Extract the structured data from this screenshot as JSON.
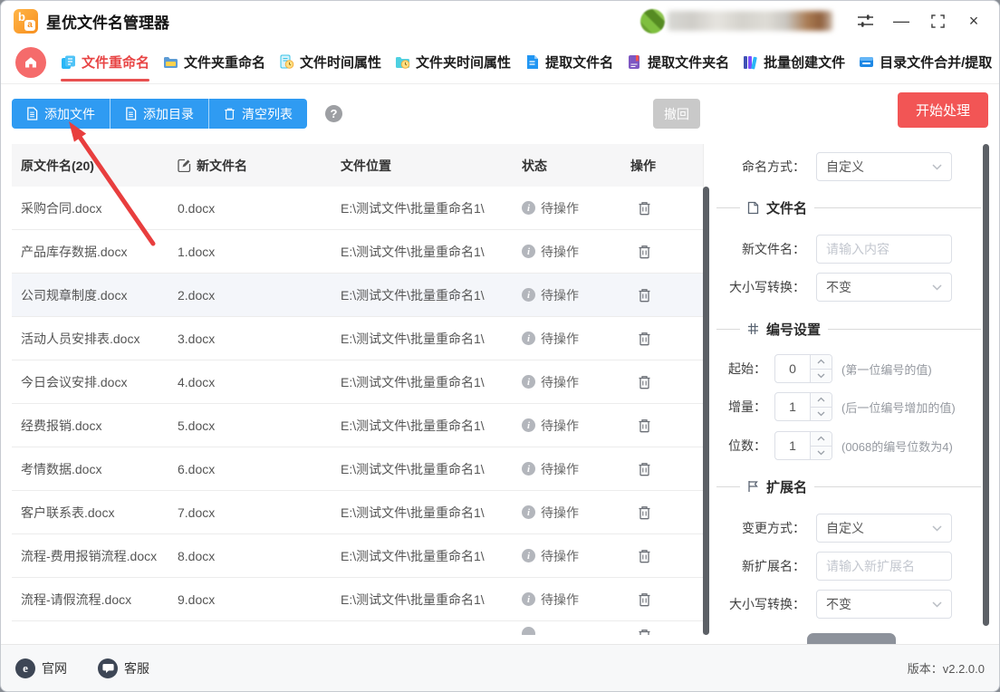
{
  "app": {
    "title": "星优文件名管理器"
  },
  "icons": {
    "minimize": "—",
    "close": "×",
    "help": "?",
    "info": "i",
    "site_glyph": "e"
  },
  "tabs": [
    {
      "label": "文件重命名",
      "active": true
    },
    {
      "label": "文件夹重命名",
      "active": false
    },
    {
      "label": "文件时间属性",
      "active": false
    },
    {
      "label": "文件夹时间属性",
      "active": false
    },
    {
      "label": "提取文件名",
      "active": false
    },
    {
      "label": "提取文件夹名",
      "active": false
    },
    {
      "label": "批量创建文件",
      "active": false
    },
    {
      "label": "目录文件合并/提取",
      "active": false
    }
  ],
  "toolbar": {
    "add_files": "添加文件",
    "add_folder": "添加目录",
    "clear_list": "清空列表",
    "undo": "撤回",
    "start": "开始处理"
  },
  "table": {
    "headers": {
      "original": "原文件名(20)",
      "new_name": "新文件名",
      "location": "文件位置",
      "status": "状态",
      "action": "操作"
    },
    "rows": [
      {
        "original": "采购合同.docx",
        "new_name": "0.docx",
        "location": "E:\\测试文件\\批量重命名1\\",
        "status": "待操作"
      },
      {
        "original": "产品库存数据.docx",
        "new_name": "1.docx",
        "location": "E:\\测试文件\\批量重命名1\\",
        "status": "待操作"
      },
      {
        "original": "公司规章制度.docx",
        "new_name": "2.docx",
        "location": "E:\\测试文件\\批量重命名1\\",
        "status": "待操作"
      },
      {
        "original": "活动人员安排表.docx",
        "new_name": "3.docx",
        "location": "E:\\测试文件\\批量重命名1\\",
        "status": "待操作"
      },
      {
        "original": "今日会议安排.docx",
        "new_name": "4.docx",
        "location": "E:\\测试文件\\批量重命名1\\",
        "status": "待操作"
      },
      {
        "original": "经费报销.docx",
        "new_name": "5.docx",
        "location": "E:\\测试文件\\批量重命名1\\",
        "status": "待操作"
      },
      {
        "original": "考情数据.docx",
        "new_name": "6.docx",
        "location": "E:\\测试文件\\批量重命名1\\",
        "status": "待操作"
      },
      {
        "original": "客户联系表.docx",
        "new_name": "7.docx",
        "location": "E:\\测试文件\\批量重命名1\\",
        "status": "待操作"
      },
      {
        "original": "流程-费用报销流程.docx",
        "new_name": "8.docx",
        "location": "E:\\测试文件\\批量重命名1\\",
        "status": "待操作"
      },
      {
        "original": "流程-请假流程.docx",
        "new_name": "9.docx",
        "location": "E:\\测试文件\\批量重命名1\\",
        "status": "待操作"
      }
    ]
  },
  "panel": {
    "naming_mode": {
      "label": "命名方式：",
      "value": "自定义"
    },
    "filename_section": {
      "title": "文件名"
    },
    "new_name": {
      "label": "新文件名：",
      "placeholder": "请输入内容"
    },
    "case_convert": {
      "label": "大小写转换：",
      "value": "不变"
    },
    "numbering_section": {
      "title": "编号设置"
    },
    "start_num": {
      "label": "起始：",
      "value": "0",
      "hint": "(第一位编号的值)"
    },
    "increment": {
      "label": "增量：",
      "value": "1",
      "hint": "(后一位编号增加的值)"
    },
    "digits": {
      "label": "位数：",
      "value": "1",
      "hint": "(0068的编号位数为4)"
    },
    "ext_section": {
      "title": "扩展名"
    },
    "change_mode": {
      "label": "变更方式：",
      "value": "自定义"
    },
    "new_ext": {
      "label": "新扩展名：",
      "placeholder": "请输入新扩展名"
    },
    "case_convert2": {
      "label": "大小写转换：",
      "value": "不变"
    }
  },
  "footer": {
    "site": "官网",
    "support": "客服",
    "version_label": "版本：",
    "version": "v2.2.0.0"
  },
  "colors": {
    "accent_blue": "#2f9bf2",
    "accent_red": "#f25555",
    "tab_active_red": "#e84545",
    "home_red": "#f56b6b"
  }
}
